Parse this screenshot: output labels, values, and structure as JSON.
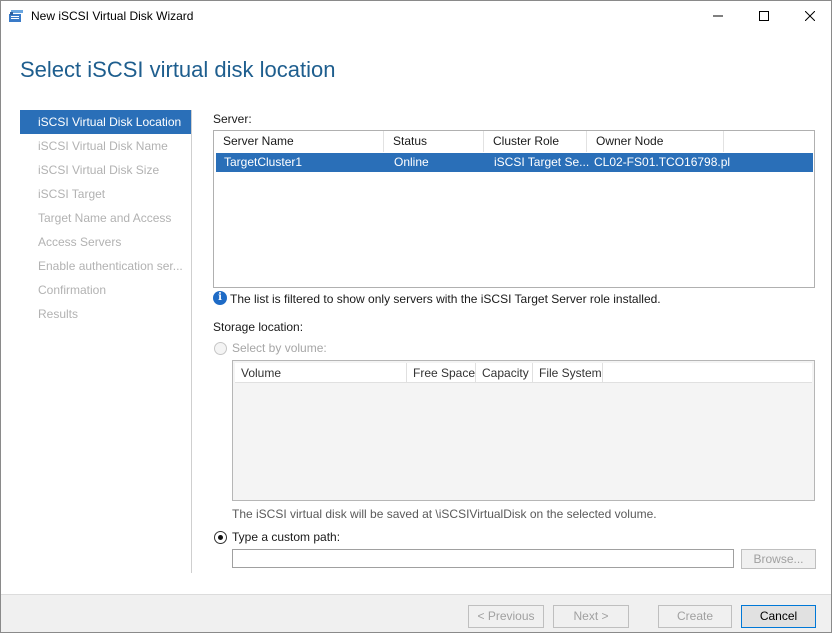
{
  "window": {
    "title": "New iSCSI Virtual Disk Wizard",
    "icon": "wizard-app-icon",
    "controls": [
      "minimize-icon",
      "maximize-icon",
      "close-icon"
    ]
  },
  "page_title": "Select iSCSI virtual disk location",
  "nav": {
    "items": [
      {
        "label": "iSCSI Virtual Disk Location",
        "active": true
      },
      {
        "label": "iSCSI Virtual Disk Name",
        "active": false
      },
      {
        "label": "iSCSI Virtual Disk Size",
        "active": false
      },
      {
        "label": "iSCSI Target",
        "active": false
      },
      {
        "label": "Target Name and Access",
        "active": false
      },
      {
        "label": "Access Servers",
        "active": false
      },
      {
        "label": "Enable authentication ser...",
        "active": false
      },
      {
        "label": "Confirmation",
        "active": false
      },
      {
        "label": "Results",
        "active": false
      }
    ]
  },
  "server": {
    "label": "Server:",
    "columns": [
      "Server Name",
      "Status",
      "Cluster Role",
      "Owner Node"
    ],
    "rows": [
      {
        "server_name": "TargetCluster1",
        "status": "Online",
        "cluster_role": "iSCSI Target Se...",
        "owner_node": "CL02-FS01.TCO16798.pl",
        "selected": true
      }
    ],
    "info_text": "The list is filtered to show only servers with the iSCSI Target Server role installed."
  },
  "storage": {
    "label": "Storage location:",
    "by_volume_label": "Select by volume:",
    "volume_columns": [
      "Volume",
      "Free Space",
      "Capacity",
      "File System"
    ],
    "save_note": "The iSCSI virtual disk will be saved at \\iSCSIVirtualDisk on the selected volume.",
    "custom_path_label": "Type a custom path:",
    "custom_path_value": "",
    "browse_label": "Browse..."
  },
  "footer": {
    "previous_label": "< Previous",
    "next_label": "Next >",
    "create_label": "Create",
    "cancel_label": "Cancel"
  },
  "colors": {
    "accent": "#2a6fb8",
    "title": "#1e5e8e",
    "nav_disabled": "#b2b2b2"
  }
}
